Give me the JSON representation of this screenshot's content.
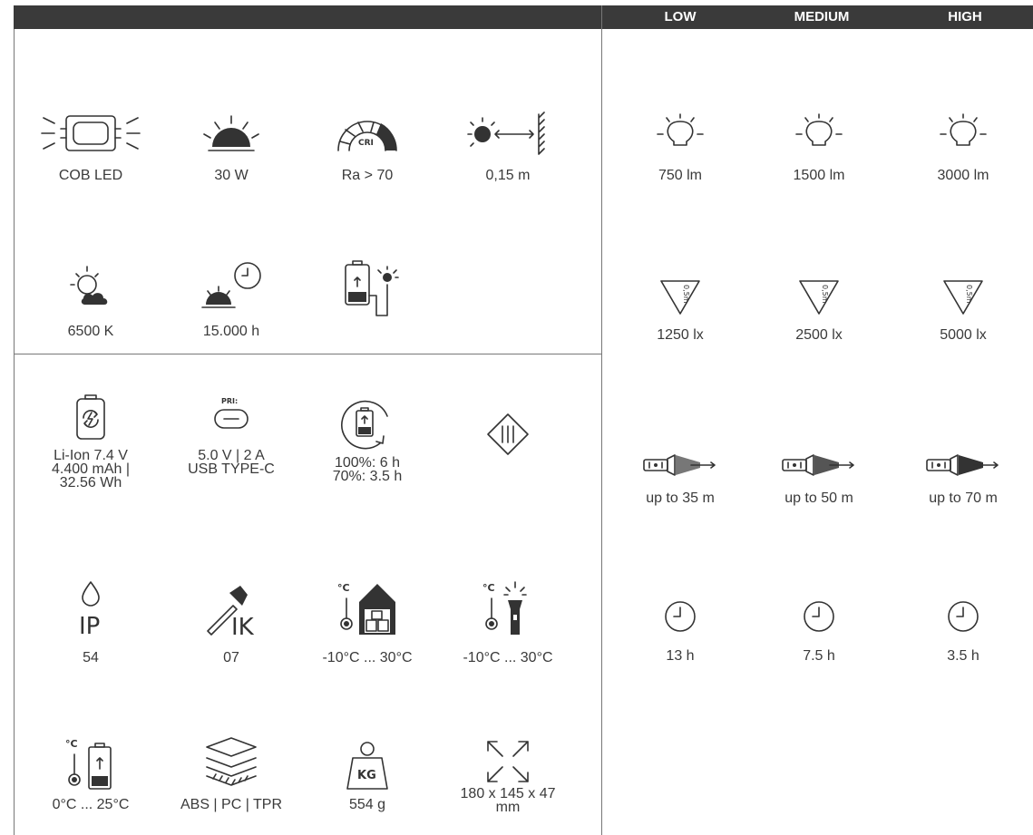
{
  "header": {
    "levels": [
      "LOW",
      "MEDIUM",
      "HIGH"
    ],
    "colors": {
      "bar": "#3a3a3a",
      "text": "#ffffff",
      "divider": "#777777"
    }
  },
  "specs": {
    "cob_led": "COB LED",
    "power": "30 W",
    "cri": "Ra > 70",
    "min_distance": "0,15 m",
    "color_temp": "6500 K",
    "lifetime": "15.000 h",
    "battery": "Li-Ion 7.4 V\n4.400 mAh |\n32.56 Wh",
    "input": "5.0 V | 2 A\nUSB TYPE-C",
    "charge_time": "100%: 6 h\n70%: 3.5 h",
    "ip_value": "54",
    "ik_value": "07",
    "operating_temp": "-10°C ... 30°C",
    "storage_temp": "-10°C ... 30°C",
    "charging_temp": "0°C ... 25°C",
    "materials": "ABS | PC | TPR",
    "weight": "554 g",
    "dimensions": "180 x 145 x 47\nmm"
  },
  "icon_labels": {
    "cri": "CRI",
    "ip": "IP",
    "ik": "IK",
    "kg": "KG",
    "pri": "PRI:",
    "celsius": "°C",
    "half_meter": "0,5m"
  },
  "modes": {
    "lumen": [
      "750 lm",
      "1500 lm",
      "3000 lm"
    ],
    "lux": [
      "1250 lx",
      "2500 lx",
      "5000 lx"
    ],
    "range": [
      "up to 35 m",
      "up to 50 m",
      "up to 70 m"
    ],
    "runtime": [
      "13 h",
      "7.5 h",
      "3.5 h"
    ]
  }
}
